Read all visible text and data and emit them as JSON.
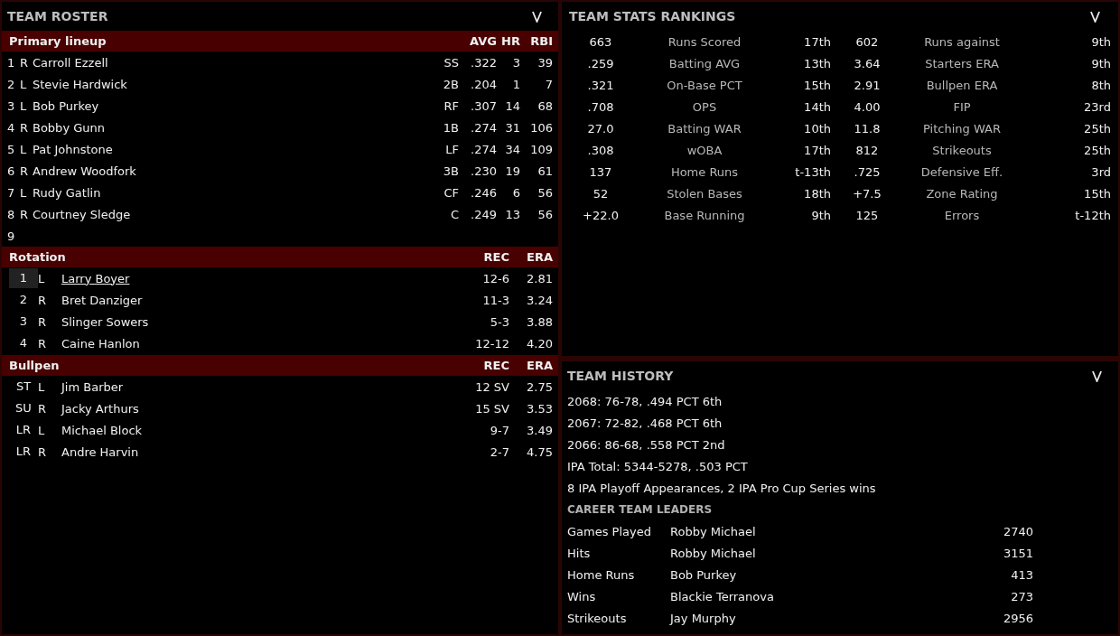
{
  "roster": {
    "title": "TEAM ROSTER",
    "lineup": {
      "label": "Primary lineup",
      "columns": [
        "AVG",
        "HR",
        "RBI"
      ],
      "rows": [
        {
          "slot": "1",
          "hand": "R",
          "name": "Carroll Ezzell",
          "pos": "SS",
          "avg": ".322",
          "hr": "3",
          "rbi": "39"
        },
        {
          "slot": "2",
          "hand": "L",
          "name": "Stevie Hardwick",
          "pos": "2B",
          "avg": ".204",
          "hr": "1",
          "rbi": "7"
        },
        {
          "slot": "3",
          "hand": "L",
          "name": "Bob Purkey",
          "pos": "RF",
          "avg": ".307",
          "hr": "14",
          "rbi": "68"
        },
        {
          "slot": "4",
          "hand": "R",
          "name": "Bobby Gunn",
          "pos": "1B",
          "avg": ".274",
          "hr": "31",
          "rbi": "106"
        },
        {
          "slot": "5",
          "hand": "L",
          "name": "Pat Johnstone",
          "pos": "LF",
          "avg": ".274",
          "hr": "34",
          "rbi": "109"
        },
        {
          "slot": "6",
          "hand": "R",
          "name": "Andrew Woodfork",
          "pos": "3B",
          "avg": ".230",
          "hr": "19",
          "rbi": "61"
        },
        {
          "slot": "7",
          "hand": "L",
          "name": "Rudy Gatlin",
          "pos": "CF",
          "avg": ".246",
          "hr": "6",
          "rbi": "56"
        },
        {
          "slot": "8",
          "hand": "R",
          "name": "Courtney Sledge",
          "pos": "C",
          "avg": ".249",
          "hr": "13",
          "rbi": "56"
        },
        {
          "slot": "9"
        }
      ]
    },
    "rotation": {
      "label": "Rotation",
      "columns": [
        "REC",
        "ERA"
      ],
      "rows": [
        {
          "slot": "1",
          "hand": "L",
          "name": "Larry Boyer",
          "rec": "12-6",
          "era": "2.81",
          "selected": true
        },
        {
          "slot": "2",
          "hand": "R",
          "name": "Bret Danziger",
          "rec": "11-3",
          "era": "3.24",
          "selected": false
        },
        {
          "slot": "3",
          "hand": "R",
          "name": "Slinger Sowers",
          "rec": "5-3",
          "era": "3.88",
          "selected": false
        },
        {
          "slot": "4",
          "hand": "R",
          "name": "Caine Hanlon",
          "rec": "12-12",
          "era": "4.20",
          "selected": false
        }
      ]
    },
    "bullpen": {
      "label": "Bullpen",
      "columns": [
        "REC",
        "ERA"
      ],
      "rows": [
        {
          "slot": "ST",
          "hand": "L",
          "name": "Jim Barber",
          "rec": "12 SV",
          "era": "2.75",
          "selected": false
        },
        {
          "slot": "SU",
          "hand": "R",
          "name": "Jacky Arthurs",
          "rec": "15 SV",
          "era": "3.53",
          "selected": false
        },
        {
          "slot": "LR",
          "hand": "L",
          "name": "Michael Block",
          "rec": "9-7",
          "era": "3.49",
          "selected": false
        },
        {
          "slot": "LR",
          "hand": "R",
          "name": "Andre Harvin",
          "rec": "2-7",
          "era": "4.75",
          "selected": false
        }
      ]
    }
  },
  "rankings": {
    "title": "TEAM STATS RANKINGS",
    "rows": [
      {
        "value": "663",
        "stat": "Runs Scored",
        "rank": "17th",
        "value_2": "602",
        "stat_2": "Runs against",
        "rank_2": "9th"
      },
      {
        "value": ".259",
        "stat": "Batting AVG",
        "rank": "13th",
        "value_2": "3.64",
        "stat_2": "Starters ERA",
        "rank_2": "9th"
      },
      {
        "value": ".321",
        "stat": "On-Base PCT",
        "rank": "15th",
        "value_2": "2.91",
        "stat_2": "Bullpen ERA",
        "rank_2": "8th"
      },
      {
        "value": ".708",
        "stat": "OPS",
        "rank": "14th",
        "value_2": "4.00",
        "stat_2": "FIP",
        "rank_2": "23rd"
      },
      {
        "value": "27.0",
        "stat": "Batting WAR",
        "rank": "10th",
        "value_2": "11.8",
        "stat_2": "Pitching WAR",
        "rank_2": "25th"
      },
      {
        "value": ".308",
        "stat": "wOBA",
        "rank": "17th",
        "value_2": "812",
        "stat_2": "Strikeouts",
        "rank_2": "25th"
      },
      {
        "value": "137",
        "stat": "Home Runs",
        "rank": "t-13th",
        "value_2": ".725",
        "stat_2": "Defensive Eff.",
        "rank_2": "3rd"
      },
      {
        "value": "52",
        "stat": "Stolen Bases",
        "rank": "18th",
        "value_2": "+7.5",
        "stat_2": "Zone Rating",
        "rank_2": "15th"
      },
      {
        "value": "+22.0",
        "stat": "Base Running",
        "rank": "9th",
        "value_2": "125",
        "stat_2": "Errors",
        "rank_2": "t-12th"
      }
    ]
  },
  "history": {
    "title": "TEAM HISTORY",
    "lines": [
      "2068: 76-78, .494 PCT 6th",
      "2067: 72-82, .468 PCT 6th",
      "2066: 86-68, .558 PCT 2nd",
      "IPA Total: 5344-5278, .503 PCT",
      "8 IPA Playoff Appearances, 2 IPA Pro Cup Series wins"
    ],
    "leaders_title": "CAREER TEAM LEADERS",
    "leaders": [
      {
        "category": "Games Played",
        "player": "Robby Michael",
        "value": "2740"
      },
      {
        "category": "Hits",
        "player": "Robby Michael",
        "value": "3151"
      },
      {
        "category": "Home Runs",
        "player": "Bob Purkey",
        "value": "413"
      },
      {
        "category": "Wins",
        "player": "Blackie Terranova",
        "value": "273"
      },
      {
        "category": "Strikeouts",
        "player": "Jay Murphy",
        "value": "2956"
      }
    ]
  }
}
